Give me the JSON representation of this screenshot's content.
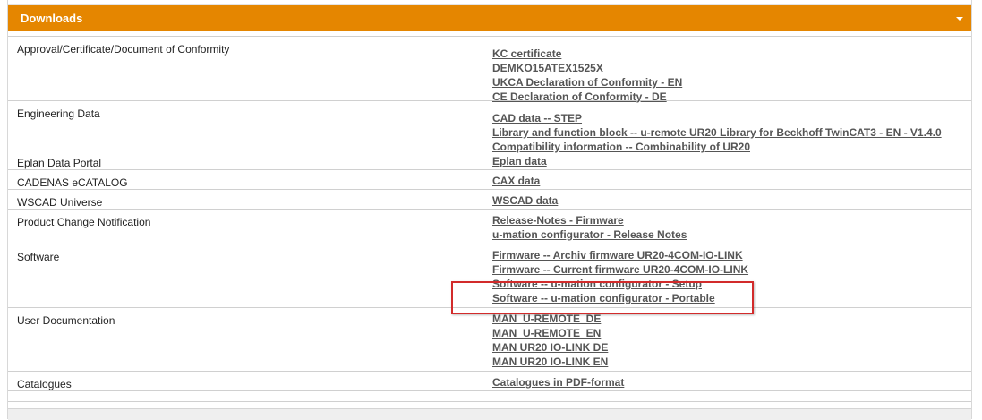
{
  "section": {
    "title": "Downloads"
  },
  "rows": [
    {
      "label": "Approval/Certificate/Document of Conformity",
      "links": [
        "KC certificate",
        "DEMKO15ATEX1525X",
        "UKCA Declaration of Conformity - EN",
        "CE Declaration of Conformity - DE"
      ]
    },
    {
      "label": "Engineering Data",
      "links": [
        "CAD data -- STEP",
        "Library and function block -- u-remote UR20 Library for Beckhoff TwinCAT3 - EN - V1.4.0",
        "Compatibility information -- Combinability of UR20"
      ]
    },
    {
      "label": "Eplan Data Portal",
      "links": [
        "Eplan data"
      ]
    },
    {
      "label": "CADENAS eCATALOG",
      "links": [
        "CAX data"
      ]
    },
    {
      "label": "WSCAD Universe",
      "links": [
        "WSCAD data"
      ]
    },
    {
      "label": "Product Change Notification",
      "links": [
        "Release-Notes - Firmware",
        "u-mation configurator - Release Notes"
      ]
    },
    {
      "label": "Software",
      "links": [
        "Firmware -- Archiv firmware UR20-4COM-IO-LINK",
        "Firmware -- Current firmware UR20-4COM-IO-LINK",
        "Software -- u-mation configurator - Setup",
        "Software -- u-mation configurator - Portable"
      ]
    },
    {
      "label": "User Documentation",
      "links": [
        "MAN_U-REMOTE_DE",
        "MAN_U-REMOTE_EN",
        "MAN UR20 IO-LINK DE",
        "MAN UR20 IO-LINK EN"
      ]
    },
    {
      "label": "Catalogues",
      "links": [
        "Catalogues in PDF-format"
      ]
    }
  ],
  "colors": {
    "header_bg": "#e58600",
    "link": "#555555",
    "highlight": "#d22b2b"
  }
}
